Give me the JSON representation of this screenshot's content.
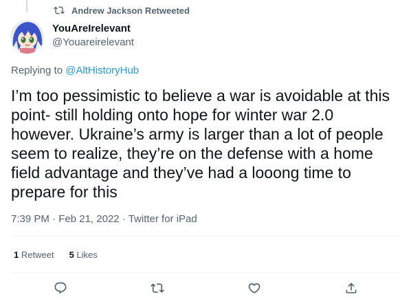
{
  "retweet_context": {
    "text": "Andrew Jackson Retweeted",
    "icon": "retweet-icon"
  },
  "author": {
    "display_name": "YouAreIrelevant",
    "handle": "@Youareirelevant",
    "avatar": "anime-girl-avatar"
  },
  "reply": {
    "prefix": "Replying to ",
    "target": "@AltHistoryHub"
  },
  "tweet": {
    "text": "I’m too pessimistic to believe a war is avoidable at this\npoint- still holding onto hope for winter war 2.0\nhowever. Ukraine’s army is larger than a lot of people\nseem to realize, they’re on the defense with a home\nfield advantage and they’ve had a looong time to\nprepare for this",
    "time": "7:39 PM",
    "date": "Feb 21, 2022",
    "source": "Twitter for iPad",
    "separator": "·"
  },
  "stats": {
    "retweets_count": "1",
    "retweets_label": "Retweet",
    "likes_count": "5",
    "likes_label": "Likes"
  },
  "actions": [
    "reply-icon",
    "retweet-icon",
    "like-icon",
    "share-icon"
  ],
  "colors": {
    "text": "#0f1419",
    "secondary": "#536471",
    "link": "#1d9bf0",
    "divider": "#eff3f4"
  }
}
